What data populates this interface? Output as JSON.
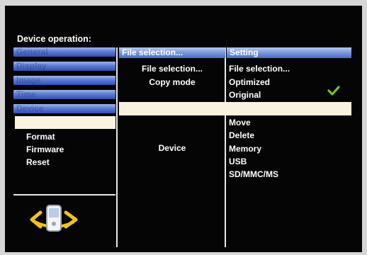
{
  "title": "Device operation:",
  "left_menu": {
    "tabs": [
      "General",
      "Display",
      "Image",
      "Time",
      "Device"
    ],
    "sub_items": [
      "Format",
      "Firmware",
      "Reset"
    ]
  },
  "middle": {
    "header": "File selection...",
    "items": [
      "File selection...",
      "Copy mode"
    ],
    "device_label": "Device"
  },
  "right": {
    "header": "Setting",
    "copy_options": [
      "File selection...",
      "Optimized",
      "Original"
    ],
    "selected_option": "Original",
    "actions": [
      "Move",
      "Delete"
    ],
    "devices": [
      "Memory",
      "USB",
      "SD/MMC/MS"
    ]
  },
  "colors": {
    "screen_bg": "#050505",
    "tab_blue": "#5c7cd4",
    "highlight_beige": "#faf2e0",
    "check_green": "#6cc42a"
  },
  "icons": [
    "device-rotate-icon",
    "check-icon"
  ]
}
